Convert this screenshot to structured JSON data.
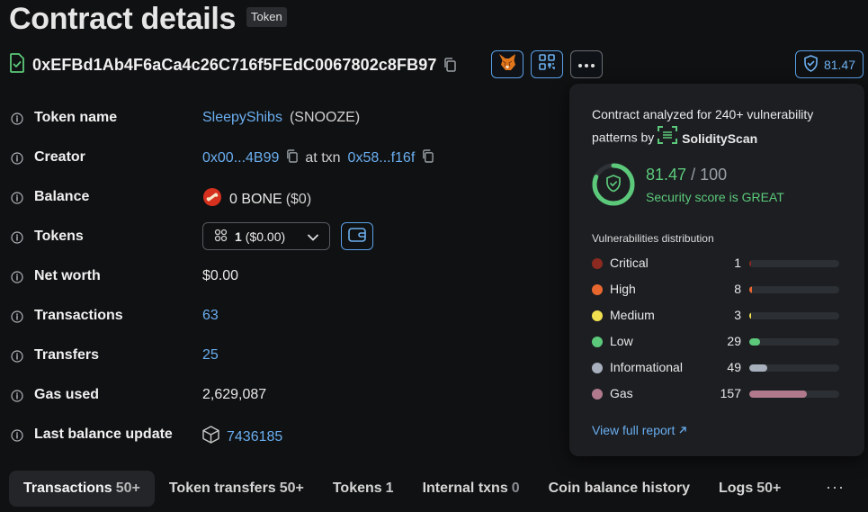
{
  "header": {
    "title": "Contract details",
    "tag": "Token",
    "address": "0xEFBd1Ab4F6aCa4c26C716f5FEdC0067802c8FB97",
    "score_button": "81.47"
  },
  "details": {
    "token_name": {
      "label": "Token name",
      "name": "SleepyShibs",
      "symbol": "(SNOOZE)"
    },
    "creator": {
      "label": "Creator",
      "address": "0x00...4B99",
      "at_txn": "at txn",
      "txn": "0x58...f16f"
    },
    "balance": {
      "label": "Balance",
      "value": "0 BONE",
      "usd": "($0)"
    },
    "tokens": {
      "label": "Tokens",
      "count": "1",
      "usd": "($0.00)"
    },
    "net_worth": {
      "label": "Net worth",
      "value": "$0.00"
    },
    "transactions": {
      "label": "Transactions",
      "value": "63"
    },
    "transfers": {
      "label": "Transfers",
      "value": "25"
    },
    "gas_used": {
      "label": "Gas used",
      "value": "2,629,087"
    },
    "last_balance_update": {
      "label": "Last balance update",
      "value": "7436185"
    }
  },
  "popup": {
    "desc_part1": "Contract analyzed for 240+ vulnerability patterns by",
    "brand": "SolidityScan",
    "score": "81.47",
    "score_of": "/ 100",
    "score_status": "Security score is GREAT",
    "score_fraction": 0.8147,
    "vuln_title": "Vulnerabilities distribution",
    "vulns": [
      {
        "name": "Critical",
        "count": "1",
        "color": "#8b2a20",
        "fraction": 0.005
      },
      {
        "name": "High",
        "count": "8",
        "color": "#e8672f",
        "fraction": 0.03
      },
      {
        "name": "Medium",
        "count": "3",
        "color": "#f0e050",
        "fraction": 0.012
      },
      {
        "name": "Low",
        "count": "29",
        "color": "#5cc97a",
        "fraction": 0.12
      },
      {
        "name": "Informational",
        "count": "49",
        "color": "#a8b0bd",
        "fraction": 0.2
      },
      {
        "name": "Gas",
        "count": "157",
        "color": "#b07a8c",
        "fraction": 0.64
      }
    ],
    "view_report": "View full report"
  },
  "tabs": [
    {
      "label": "Transactions",
      "count": "50+",
      "active": true
    },
    {
      "label": "Token transfers",
      "count": "50+"
    },
    {
      "label": "Tokens",
      "count": "1"
    },
    {
      "label": "Internal txns",
      "count": "0"
    },
    {
      "label": "Coin balance history",
      "count": ""
    },
    {
      "label": "Logs",
      "count": "50+"
    }
  ],
  "tabs_more": "···",
  "colors": {
    "accent": "#6aaef0",
    "good": "#5cc97a",
    "background": "#101112",
    "popup": "#1c1e22"
  }
}
